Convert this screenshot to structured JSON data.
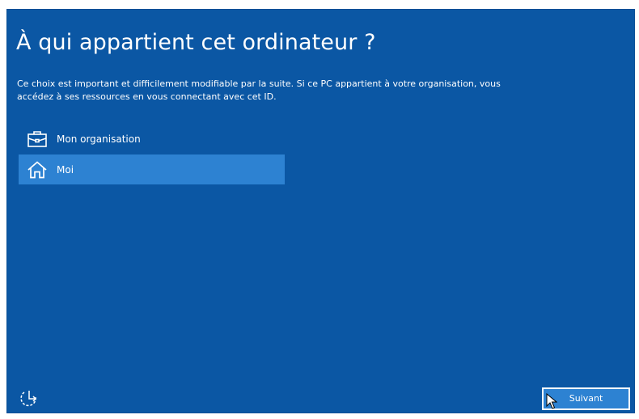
{
  "page": {
    "title": "À qui appartient cet ordinateur ?",
    "description": "Ce choix est important et difficilement modifiable par la suite. Si ce PC appartient à votre organisation, vous accédez à ses ressources en vous connectant avec cet ID."
  },
  "options": [
    {
      "label": "Mon organisation",
      "icon": "briefcase-icon",
      "selected": false
    },
    {
      "label": "Moi",
      "icon": "home-icon",
      "selected": true
    }
  ],
  "footer": {
    "accessibility_icon": "accessibility-icon",
    "next_label": "Suivant"
  },
  "colors": {
    "background": "#0b57a4",
    "selected": "#2d82d2",
    "text": "#ffffff"
  }
}
